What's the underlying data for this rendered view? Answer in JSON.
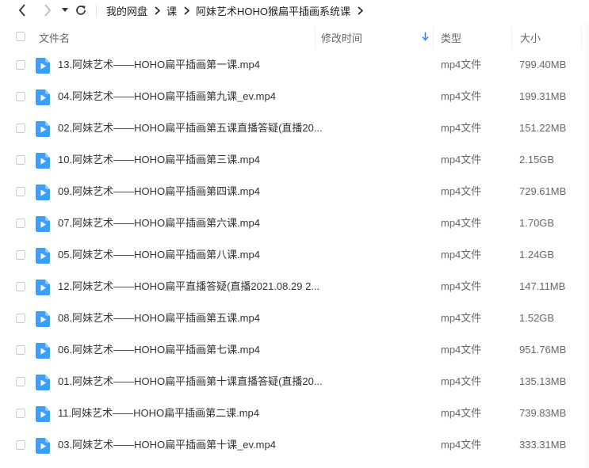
{
  "breadcrumb": [
    "我的网盘",
    "课",
    "阿妹艺术HOHO猴扁平插画系统课"
  ],
  "columns": {
    "name": "文件名",
    "mtime": "修改时间",
    "type": "类型",
    "size": "大小"
  },
  "files": [
    {
      "name": "13.阿妹艺术——HOHO扁平插画第一课.mp4",
      "type": "mp4文件",
      "size": "799.40MB"
    },
    {
      "name": "04.阿妹艺术——HOHO扁平插画第九课_ev.mp4",
      "type": "mp4文件",
      "size": "199.31MB"
    },
    {
      "name": "02.阿妹艺术——HOHO扁平插画第五课直播答疑(直播20...",
      "type": "mp4文件",
      "size": "151.22MB"
    },
    {
      "name": "10.阿妹艺术——HOHO扁平插画第三课.mp4",
      "type": "mp4文件",
      "size": "2.15GB"
    },
    {
      "name": "09.阿妹艺术——HOHO扁平插画第四课.mp4",
      "type": "mp4文件",
      "size": "729.61MB"
    },
    {
      "name": "07.阿妹艺术——HOHO扁平插画第六课.mp4",
      "type": "mp4文件",
      "size": "1.70GB"
    },
    {
      "name": "05.阿妹艺术——HOHO扁平插画第八课.mp4",
      "type": "mp4文件",
      "size": "1.24GB"
    },
    {
      "name": "12.阿妹艺术——HOHO扁平直播答疑(直播2021.08.29 2...",
      "type": "mp4文件",
      "size": "147.11MB"
    },
    {
      "name": "08.阿妹艺术——HOHO扁平插画第五课.mp4",
      "type": "mp4文件",
      "size": "1.52GB"
    },
    {
      "name": "06.阿妹艺术——HOHO扁平插画第七课.mp4",
      "type": "mp4文件",
      "size": "951.76MB"
    },
    {
      "name": "01.阿妹艺术——HOHO扁平插画第十课直播答疑(直播20...",
      "type": "mp4文件",
      "size": "135.13MB"
    },
    {
      "name": "11.阿妹艺术——HOHO扁平插画第二课.mp4",
      "type": "mp4文件",
      "size": "739.83MB"
    },
    {
      "name": "03.阿妹艺术——HOHO扁平插画第十课_ev.mp4",
      "type": "mp4文件",
      "size": "333.31MB"
    }
  ],
  "colors": {
    "file_icon": "#3aa0ff",
    "sort_arrow": "#2e8cf0"
  }
}
